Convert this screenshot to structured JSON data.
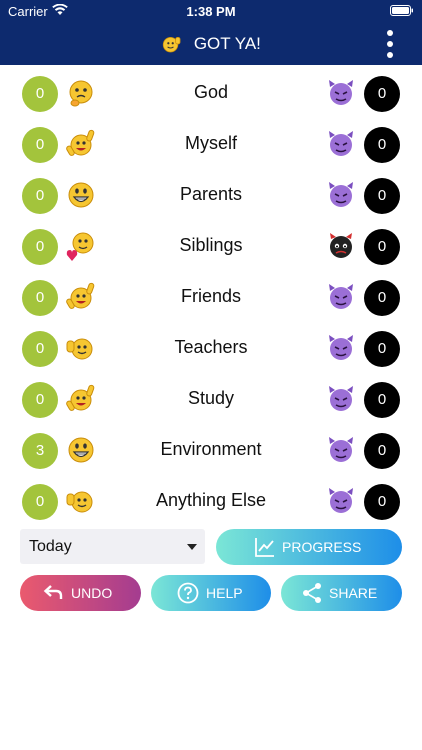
{
  "status": {
    "carrier": "Carrier",
    "time": "1:38 PM"
  },
  "header": {
    "title": "GOT YA!",
    "logo_icon": "thumbs-up-smiley-icon",
    "menu_icon": "more-vertical-icon"
  },
  "rows": [
    {
      "label": "God",
      "good": "0",
      "bad": "0",
      "good_icon": "thinking-smiley-icon",
      "bad_icon": "purple-devil-icon"
    },
    {
      "label": "Myself",
      "good": "0",
      "bad": "0",
      "good_icon": "cheering-smiley-icon",
      "bad_icon": "purple-devil-icon"
    },
    {
      "label": "Parents",
      "good": "0",
      "bad": "0",
      "good_icon": "grinning-smiley-icon",
      "bad_icon": "purple-devil-icon"
    },
    {
      "label": "Siblings",
      "good": "0",
      "bad": "0",
      "good_icon": "heart-smiley-icon",
      "bad_icon": "black-devil-icon"
    },
    {
      "label": "Friends",
      "good": "0",
      "bad": "0",
      "good_icon": "cheering-smiley-icon",
      "bad_icon": "purple-devil-icon"
    },
    {
      "label": "Teachers",
      "good": "0",
      "bad": "0",
      "good_icon": "thumbs-up-smiley-icon",
      "bad_icon": "purple-devil-icon"
    },
    {
      "label": "Study",
      "good": "0",
      "bad": "0",
      "good_icon": "cheering-smiley-icon",
      "bad_icon": "purple-devil-icon"
    },
    {
      "label": "Environment",
      "good": "3",
      "bad": "0",
      "good_icon": "grinning-smiley-icon",
      "bad_icon": "purple-devil-icon"
    },
    {
      "label": "Anything Else",
      "good": "0",
      "bad": "0",
      "good_icon": "thumbs-up-smiley-icon",
      "bad_icon": "purple-devil-icon"
    }
  ],
  "controls": {
    "period": "Today",
    "progress": "PROGRESS",
    "undo": "UNDO",
    "help": "HELP",
    "share": "SHARE"
  },
  "colors": {
    "header": "#0d2a6e",
    "good": "#a3c43c",
    "bad": "#000000"
  }
}
